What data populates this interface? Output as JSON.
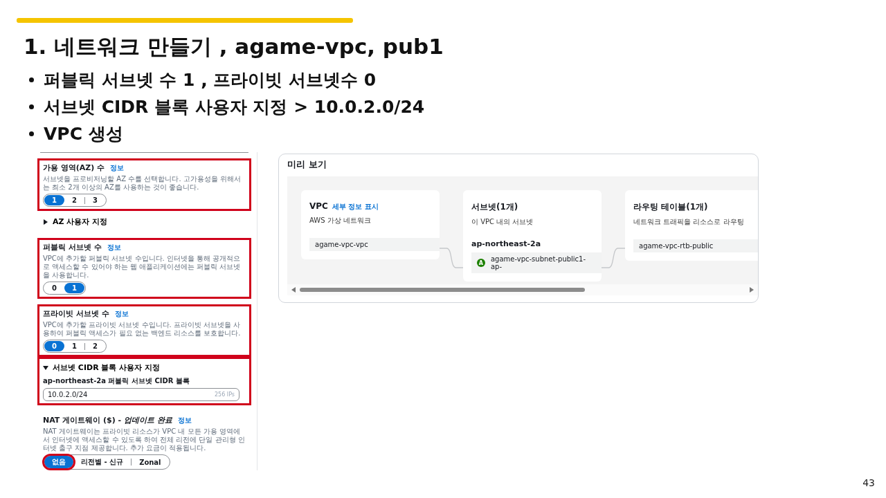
{
  "slide": {
    "title": "1. 네트워크 만들기 , agame-vpc, pub1",
    "bullets": [
      "퍼블릭 서브넷 수 1 , 프라이빗 서브넷수 0",
      "서브넷 CIDR 블록 사용자 지정 > 10.0.2.0/24",
      "VPC 생성"
    ],
    "page_number": "43"
  },
  "settings": {
    "sections": [
      {
        "kind": "segmented",
        "highlighted": true,
        "title": "가용 영역(AZ) 수",
        "info": "정보",
        "description": "서브넷을 프로비저닝할 AZ 수를 선택합니다. 고가용성을 위해서는 최소 2개 이상의 AZ를 사용하는 것이 좋습니다.",
        "options": [
          {
            "label": "1",
            "selected": true
          },
          {
            "label": "2",
            "selected": false
          },
          {
            "label": "3",
            "selected": false
          }
        ]
      },
      {
        "kind": "expander",
        "highlighted": false,
        "label": "AZ 사용자 지정",
        "expanded": false
      },
      {
        "kind": "segmented",
        "highlighted": true,
        "title": "퍼블릭 서브넷 수",
        "info": "정보",
        "description": "VPC에 추가할 퍼블릭 서브넷 수입니다. 인터넷을 통해 공개적으로 액세스할 수 있어야 하는 웹 애플리케이션에는 퍼블릭 서브넷을 사용합니다.",
        "options": [
          {
            "label": "0",
            "selected": false
          },
          {
            "label": "1",
            "selected": true
          }
        ]
      },
      {
        "kind": "segmented",
        "highlighted": true,
        "title": "프라이빗 서브넷 수",
        "info": "정보",
        "description": "VPC에 추가할 프라이빗 서브넷 수입니다. 프라이빗 서브넷을 사용하여 퍼블릭 액세스가 필요 없는 백엔드 리소스를 보호합니다.",
        "options": [
          {
            "label": "0",
            "selected": true
          },
          {
            "label": "1",
            "selected": false
          },
          {
            "label": "2",
            "selected": false
          }
        ]
      },
      {
        "kind": "cidr",
        "highlighted": true,
        "label": "서브넷 CIDR 블록 사용자 지정",
        "expanded": true,
        "field_label": "ap-northeast-2a 퍼블릭 서브넷 CIDR 블록",
        "value": "10.0.2.0/24",
        "suffix": "256 IPs"
      },
      {
        "kind": "segmented",
        "highlighted": false,
        "title": "NAT 게이트웨이 ($) - *업데이트 완료*",
        "info": "정보",
        "description": "NAT 게이트웨이는 프라이빗 리소스가 VPC 내 모든 가용 영역에서 인터넷에 액세스할 수 있도록 하여 전체 리전에 단일 관리형 인터넷 출구 지점 제공합니다. 추가 요금이 적용됩니다.",
        "options": [
          {
            "label": "없음",
            "selected": true,
            "highlighted": true
          },
          {
            "label": "리전별 - 신규",
            "selected": false,
            "highlighted": false
          },
          {
            "label": "Zonal",
            "selected": false,
            "highlighted": false
          }
        ]
      }
    ]
  },
  "preview": {
    "title": "미리 보기",
    "cards": [
      {
        "title": "VPC",
        "link": "세부 정보 표시",
        "subtitle": "AWS 가상 네트워크",
        "items": [
          {
            "label": "agame-vpc-vpc"
          }
        ]
      },
      {
        "title": "서브넷(1개)",
        "subtitle": "이 VPC 내의 서브넷",
        "group": "ap-northeast-2a",
        "items": [
          {
            "label": "agame-vpc-subnet-public1-ap-",
            "badge": "A"
          }
        ]
      },
      {
        "title": "라우팅 테이블(1개)",
        "subtitle": "네트워크 트래픽을 리소스로 라우팅",
        "items": [
          {
            "label": "agame-vpc-rtb-public"
          }
        ]
      }
    ]
  }
}
